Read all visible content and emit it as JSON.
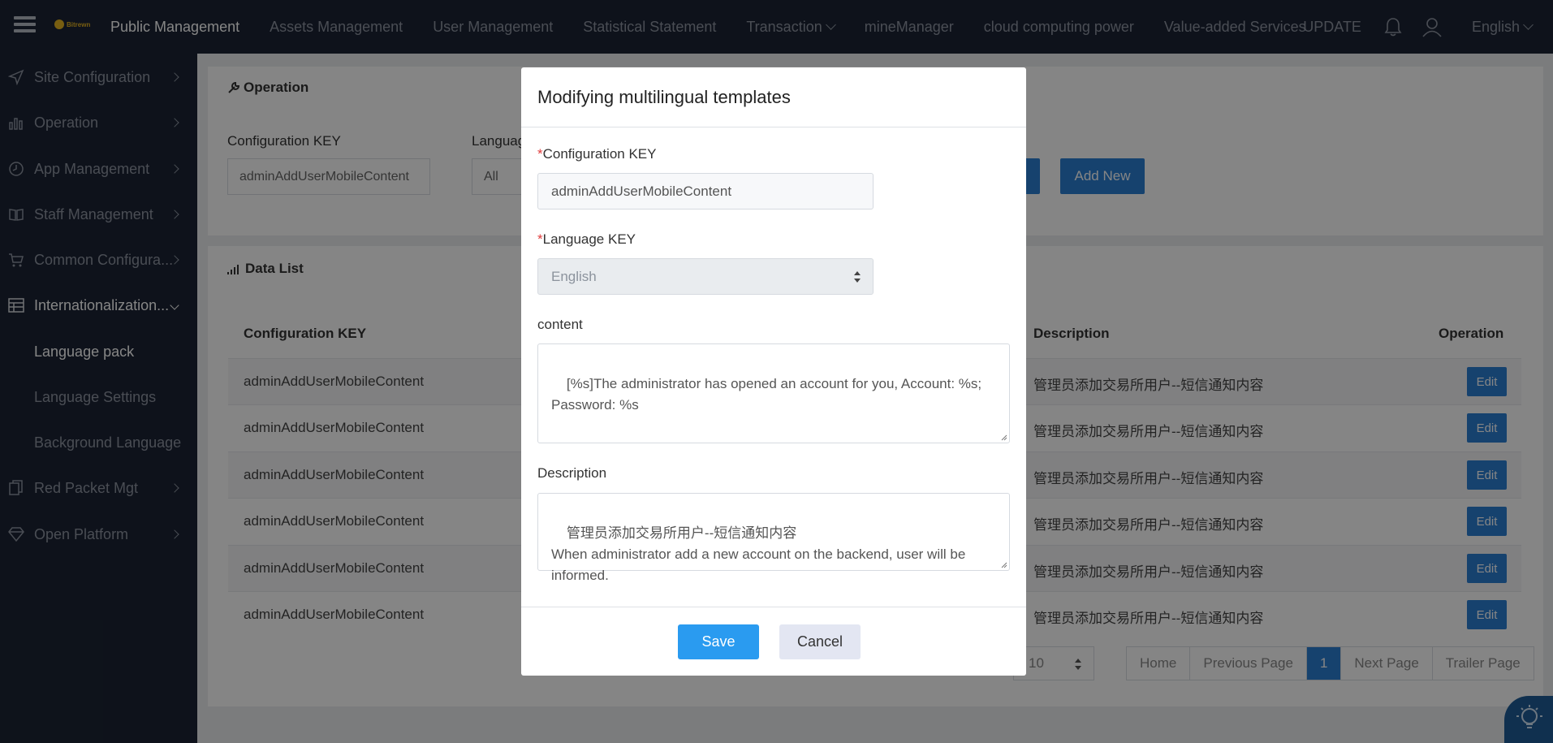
{
  "topbar": {
    "logo_text": "Bitrewn",
    "nav": [
      "Public Management",
      "Assets Management",
      "User Management",
      "Statistical Statement",
      "Transaction",
      "mineManager",
      "cloud computing power",
      "Value-added Services"
    ],
    "update_label": "UPDATE",
    "language": "English"
  },
  "sidebar": {
    "items": [
      {
        "label": "Site Configuration",
        "icon": "send-icon"
      },
      {
        "label": "Operation",
        "icon": "bar-chart-icon"
      },
      {
        "label": "App Management",
        "icon": "clock-icon"
      },
      {
        "label": "Staff Management",
        "icon": "book-icon"
      },
      {
        "label": "Common Configura...",
        "icon": "cart-icon"
      },
      {
        "label": "Internationalization...",
        "icon": "table-icon"
      },
      {
        "label": "Red Packet Mgt",
        "icon": "copy-icon"
      },
      {
        "label": "Open Platform",
        "icon": "diamond-icon"
      }
    ],
    "sub_items": [
      "Language pack",
      "Language Settings",
      "Background Language"
    ]
  },
  "operation_panel": {
    "title": "Operation",
    "config_key_label": "Configuration KEY",
    "config_key_value": "adminAddUserMobileContent",
    "language_label": "Language",
    "language_value": "All",
    "add_new_label": "Add New"
  },
  "data_panel": {
    "title": "Data List",
    "columns": {
      "config_key": "Configuration KEY",
      "description": "Description",
      "operation": "Operation"
    },
    "rows": [
      {
        "key": "adminAddUserMobileContent",
        "description": "管理员添加交易所用户--短信通知内容",
        "action": "Edit"
      },
      {
        "key": "adminAddUserMobileContent",
        "description": "管理员添加交易所用户--短信通知内容",
        "action": "Edit"
      },
      {
        "key": "adminAddUserMobileContent",
        "description": "管理员添加交易所用户--短信通知内容",
        "action": "Edit"
      },
      {
        "key": "adminAddUserMobileContent",
        "description": "管理员添加交易所用户--短信通知内容",
        "action": "Edit"
      },
      {
        "key": "adminAddUserMobileContent",
        "description": "管理员添加交易所用户--短信通知内容",
        "action": "Edit"
      },
      {
        "key": "adminAddUserMobileContent",
        "description": "管理员添加交易所用户--短信通知内容",
        "action": "Edit"
      }
    ],
    "page_size": "10",
    "pager": [
      "Home",
      "Previous Page",
      "1",
      "Next Page",
      "Trailer Page"
    ]
  },
  "modal": {
    "title": "Modifying multilingual templates",
    "config_key_label": "Configuration KEY",
    "config_key_value": "adminAddUserMobileContent",
    "language_key_label": "Language KEY",
    "language_key_value": "English",
    "content_label": "content",
    "content_value": "[%s]The administrator has opened an account for you, Account: %s;\nPassword: %s",
    "description_label": "Description",
    "description_value": "管理员添加交易所用户--短信通知内容\nWhen administrator add a new account on the backend, user will be\ninformed.",
    "save_label": "Save",
    "cancel_label": "Cancel",
    "required_mark": "*"
  },
  "colors": {
    "topbar": "#1b2434",
    "accent": "#2b7fd4",
    "save": "#2a9bf0",
    "required": "#e03c3c"
  }
}
